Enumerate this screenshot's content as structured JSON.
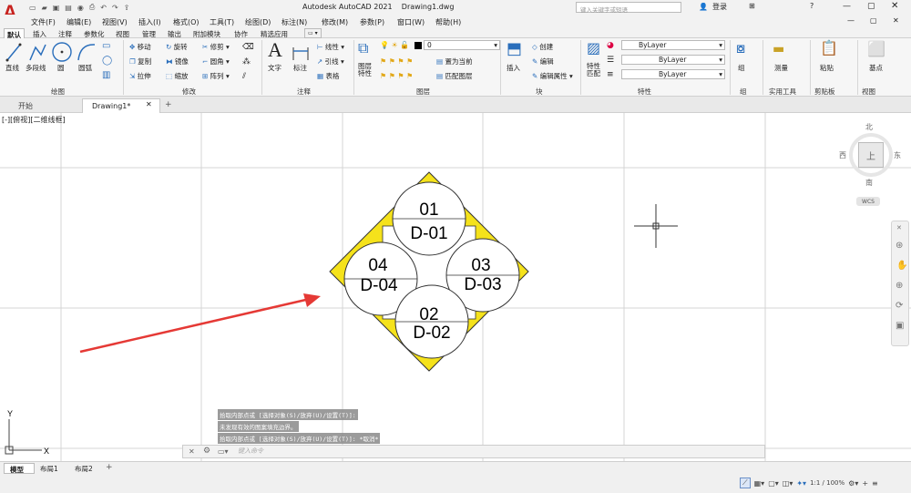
{
  "app": {
    "title": "Autodesk AutoCAD 2021",
    "filename": "Drawing1.dwg",
    "search_placeholder": "键入关键字或短语",
    "login": "登录",
    "brand_color": "#c7221e"
  },
  "menu": [
    "文件(F)",
    "编辑(E)",
    "视图(V)",
    "插入(I)",
    "格式(O)",
    "工具(T)",
    "绘图(D)",
    "标注(N)",
    "修改(M)",
    "参数(P)",
    "窗口(W)",
    "帮助(H)"
  ],
  "ribbon_tabs": [
    "默认",
    "插入",
    "注释",
    "参数化",
    "视图",
    "管理",
    "输出",
    "附加模块",
    "协作",
    "精选应用"
  ],
  "panels": {
    "draw": {
      "label": "绘图",
      "tools": [
        "直线",
        "多段线",
        "圆",
        "圆弧"
      ]
    },
    "modify": {
      "label": "修改",
      "tools": [
        "移动",
        "旋转",
        "修剪",
        "复制",
        "镜像",
        "圆角",
        "拉伸",
        "缩放",
        "阵列"
      ]
    },
    "annotation": {
      "label": "注释",
      "tools": [
        "文字",
        "标注",
        "线性",
        "引线",
        "表格"
      ]
    },
    "layers": {
      "label": "图层",
      "tools": [
        "图层特性",
        "置为当前",
        "匹配图层"
      ],
      "current_layer": "0"
    },
    "block": {
      "label": "块",
      "tools": [
        "插入",
        "创建",
        "编辑",
        "编辑属性"
      ]
    },
    "properties": {
      "label": "特性",
      "tools": [
        "特性匹配"
      ],
      "color": "ByLayer",
      "linetype": "ByLayer",
      "lineweight": "ByLayer"
    },
    "group": {
      "label": "组",
      "tools": [
        "组"
      ]
    },
    "utilities": {
      "label": "实用工具",
      "tools": [
        "测量"
      ]
    },
    "clipboard": {
      "label": "剪贴板",
      "tools": [
        "粘贴"
      ]
    },
    "view": {
      "label": "视图",
      "tools": [
        "基点"
      ]
    }
  },
  "file_tabs": [
    "开始",
    "Drawing1*"
  ],
  "viewport_label": "[-][俯视][二维线框]",
  "viewcube": {
    "north": "北",
    "south": "南",
    "east": "东",
    "west": "西",
    "top": "上",
    "wcs": "WCS"
  },
  "ucs": {
    "y": "Y",
    "x": "X"
  },
  "drawing": {
    "circles": [
      {
        "num": "01",
        "code": "D-01"
      },
      {
        "num": "02",
        "code": "D-02"
      },
      {
        "num": "03",
        "code": "D-03"
      },
      {
        "num": "04",
        "code": "D-04"
      }
    ],
    "fill_color": "#f5e21b",
    "arrow_color": "#e53935"
  },
  "command_history": [
    "拾取内部点或 [选择对象(S)/放弃(U)/设置(T)]:",
    "未发现有效的图案填充边界。",
    "拾取内部点或 [选择对象(S)/放弃(U)/设置(T)]: *取消*"
  ],
  "command_placeholder": "键入命令",
  "layout_tabs": [
    "模型",
    "布局1",
    "布局2"
  ],
  "status": {
    "scale": "1:1 / 100%"
  }
}
